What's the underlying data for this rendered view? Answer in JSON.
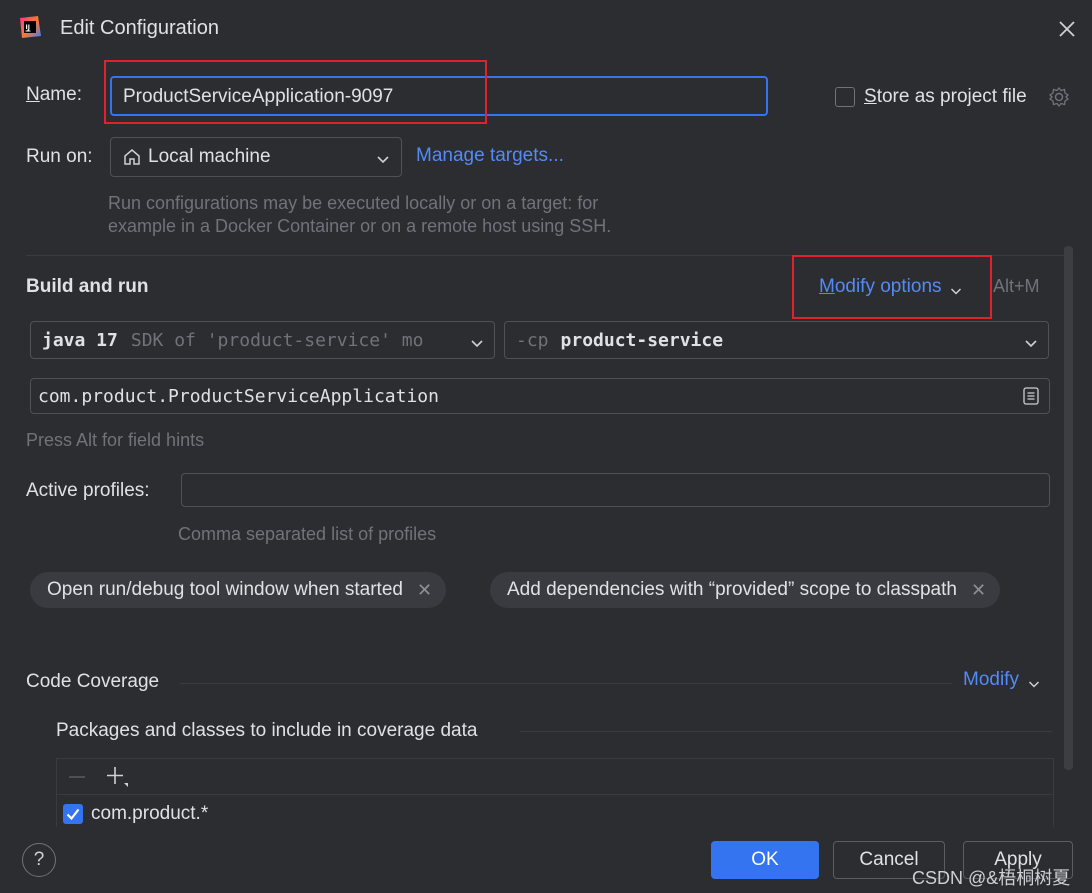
{
  "window": {
    "title": "Edit Configuration",
    "icon": "intellij-logo-icon"
  },
  "name_row": {
    "label_prefix": "N",
    "label_rest": "ame:",
    "value": "ProductServiceApplication-9097",
    "store_checked": false,
    "store_label_prefix": "S",
    "store_label_rest": "tore as project file"
  },
  "run_on": {
    "label": "Run on:",
    "value": "Local machine",
    "manage_targets": "Manage targets...",
    "hint_line1": "Run configurations may be executed locally or on a target: for",
    "hint_line2": "example in a Docker Container or on a remote host using SSH."
  },
  "build_and_run": {
    "title": "Build and run",
    "modify_prefix": "M",
    "modify_rest": "odify options",
    "shortcut": "Alt+M",
    "jdk_bold": "java 17",
    "jdk_muted": "SDK of 'product-service' mo",
    "cp_muted": "-cp",
    "cp_value": "product-service",
    "main_class": "com.product.ProductServiceApplication",
    "field_hint": "Press Alt for field hints",
    "profiles_label": "Active profiles:",
    "profiles_value": "",
    "profiles_hint": "Comma separated list of profiles",
    "chips": [
      "Open run/debug tool window when started",
      "Add dependencies with “provided” scope to classpath"
    ]
  },
  "coverage": {
    "title": "Code Coverage",
    "modify": "Modify",
    "packages_title": "Packages and classes to include in coverage data",
    "items": [
      {
        "label": "com.product.*",
        "checked": true
      }
    ]
  },
  "footer": {
    "help": "?",
    "ok": "OK",
    "cancel": "Cancel",
    "apply": "Apply",
    "watermark": "CSDN @&梧桐树夏"
  },
  "colors": {
    "background": "#2b2d30",
    "accent": "#548af7",
    "primary_button": "#3574f0",
    "highlight_box": "#e0212e"
  }
}
